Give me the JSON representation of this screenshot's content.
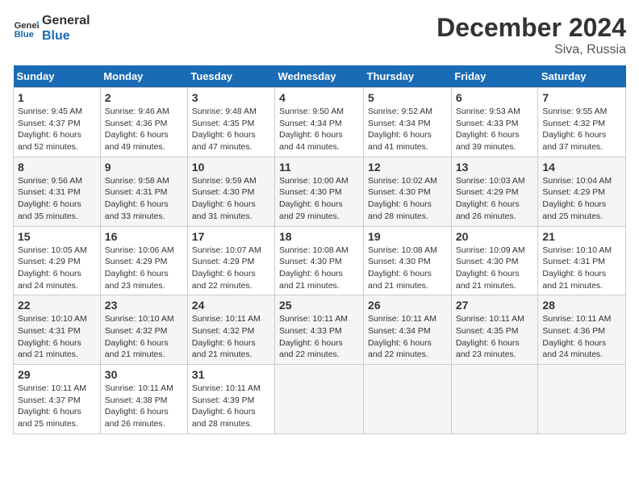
{
  "logo": {
    "line1": "General",
    "line2": "Blue"
  },
  "title": "December 2024",
  "subtitle": "Siva, Russia",
  "weekdays": [
    "Sunday",
    "Monday",
    "Tuesday",
    "Wednesday",
    "Thursday",
    "Friday",
    "Saturday"
  ],
  "weeks": [
    [
      {
        "day": "1",
        "sunrise": "9:45 AM",
        "sunset": "4:37 PM",
        "daylight": "6 hours and 52 minutes."
      },
      {
        "day": "2",
        "sunrise": "9:46 AM",
        "sunset": "4:36 PM",
        "daylight": "6 hours and 49 minutes."
      },
      {
        "day": "3",
        "sunrise": "9:48 AM",
        "sunset": "4:35 PM",
        "daylight": "6 hours and 47 minutes."
      },
      {
        "day": "4",
        "sunrise": "9:50 AM",
        "sunset": "4:34 PM",
        "daylight": "6 hours and 44 minutes."
      },
      {
        "day": "5",
        "sunrise": "9:52 AM",
        "sunset": "4:34 PM",
        "daylight": "6 hours and 41 minutes."
      },
      {
        "day": "6",
        "sunrise": "9:53 AM",
        "sunset": "4:33 PM",
        "daylight": "6 hours and 39 minutes."
      },
      {
        "day": "7",
        "sunrise": "9:55 AM",
        "sunset": "4:32 PM",
        "daylight": "6 hours and 37 minutes."
      }
    ],
    [
      {
        "day": "8",
        "sunrise": "9:56 AM",
        "sunset": "4:31 PM",
        "daylight": "6 hours and 35 minutes."
      },
      {
        "day": "9",
        "sunrise": "9:58 AM",
        "sunset": "4:31 PM",
        "daylight": "6 hours and 33 minutes."
      },
      {
        "day": "10",
        "sunrise": "9:59 AM",
        "sunset": "4:30 PM",
        "daylight": "6 hours and 31 minutes."
      },
      {
        "day": "11",
        "sunrise": "10:00 AM",
        "sunset": "4:30 PM",
        "daylight": "6 hours and 29 minutes."
      },
      {
        "day": "12",
        "sunrise": "10:02 AM",
        "sunset": "4:30 PM",
        "daylight": "6 hours and 28 minutes."
      },
      {
        "day": "13",
        "sunrise": "10:03 AM",
        "sunset": "4:29 PM",
        "daylight": "6 hours and 26 minutes."
      },
      {
        "day": "14",
        "sunrise": "10:04 AM",
        "sunset": "4:29 PM",
        "daylight": "6 hours and 25 minutes."
      }
    ],
    [
      {
        "day": "15",
        "sunrise": "10:05 AM",
        "sunset": "4:29 PM",
        "daylight": "6 hours and 24 minutes."
      },
      {
        "day": "16",
        "sunrise": "10:06 AM",
        "sunset": "4:29 PM",
        "daylight": "6 hours and 23 minutes."
      },
      {
        "day": "17",
        "sunrise": "10:07 AM",
        "sunset": "4:29 PM",
        "daylight": "6 hours and 22 minutes."
      },
      {
        "day": "18",
        "sunrise": "10:08 AM",
        "sunset": "4:30 PM",
        "daylight": "6 hours and 21 minutes."
      },
      {
        "day": "19",
        "sunrise": "10:08 AM",
        "sunset": "4:30 PM",
        "daylight": "6 hours and 21 minutes."
      },
      {
        "day": "20",
        "sunrise": "10:09 AM",
        "sunset": "4:30 PM",
        "daylight": "6 hours and 21 minutes."
      },
      {
        "day": "21",
        "sunrise": "10:10 AM",
        "sunset": "4:31 PM",
        "daylight": "6 hours and 21 minutes."
      }
    ],
    [
      {
        "day": "22",
        "sunrise": "10:10 AM",
        "sunset": "4:31 PM",
        "daylight": "6 hours and 21 minutes."
      },
      {
        "day": "23",
        "sunrise": "10:10 AM",
        "sunset": "4:32 PM",
        "daylight": "6 hours and 21 minutes."
      },
      {
        "day": "24",
        "sunrise": "10:11 AM",
        "sunset": "4:32 PM",
        "daylight": "6 hours and 21 minutes."
      },
      {
        "day": "25",
        "sunrise": "10:11 AM",
        "sunset": "4:33 PM",
        "daylight": "6 hours and 22 minutes."
      },
      {
        "day": "26",
        "sunrise": "10:11 AM",
        "sunset": "4:34 PM",
        "daylight": "6 hours and 22 minutes."
      },
      {
        "day": "27",
        "sunrise": "10:11 AM",
        "sunset": "4:35 PM",
        "daylight": "6 hours and 23 minutes."
      },
      {
        "day": "28",
        "sunrise": "10:11 AM",
        "sunset": "4:36 PM",
        "daylight": "6 hours and 24 minutes."
      }
    ],
    [
      {
        "day": "29",
        "sunrise": "10:11 AM",
        "sunset": "4:37 PM",
        "daylight": "6 hours and 25 minutes."
      },
      {
        "day": "30",
        "sunrise": "10:11 AM",
        "sunset": "4:38 PM",
        "daylight": "6 hours and 26 minutes."
      },
      {
        "day": "31",
        "sunrise": "10:11 AM",
        "sunset": "4:39 PM",
        "daylight": "6 hours and 28 minutes."
      },
      null,
      null,
      null,
      null
    ]
  ]
}
